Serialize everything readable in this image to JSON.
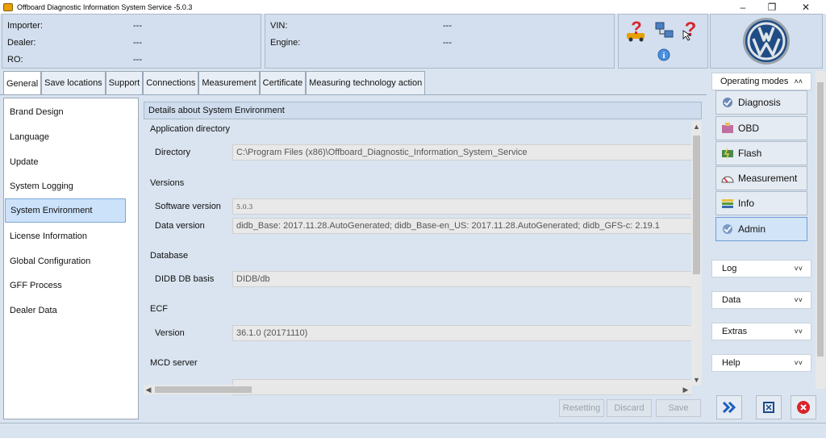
{
  "window": {
    "title": "Offboard Diagnostic Information System Service -5.0.3",
    "minimize_icon": "minimize-icon",
    "maximize_icon": "restore-icon",
    "close_icon": "close-icon"
  },
  "header": {
    "importer_label": "Importer:",
    "importer_value": "---",
    "dealer_label": "Dealer:",
    "dealer_value": "---",
    "ro_label": "RO:",
    "ro_value": "---",
    "vin_label": "VIN:",
    "vin_value": "---",
    "engine_label": "Engine:",
    "engine_value": "---"
  },
  "tabs": [
    {
      "label": "General"
    },
    {
      "label": "Save locations"
    },
    {
      "label": "Support"
    },
    {
      "label": "Connections"
    },
    {
      "label": "Measurement"
    },
    {
      "label": "Certificate"
    },
    {
      "label": "Measuring technology action"
    }
  ],
  "leftnav": [
    {
      "label": "Brand Design"
    },
    {
      "label": "Language"
    },
    {
      "label": "Update"
    },
    {
      "label": "System Logging"
    },
    {
      "label": "System Environment"
    },
    {
      "label": "License Information"
    },
    {
      "label": "Global Configuration"
    },
    {
      "label": "GFF Process"
    },
    {
      "label": "Dealer Data"
    }
  ],
  "content": {
    "header": "Details about System Environment",
    "sections": {
      "app_dir": "Application directory",
      "directory_label": "Directory",
      "directory_value": "C:\\Program Files (x86)\\Offboard_Diagnostic_Information_System_Service",
      "versions": "Versions",
      "software_label": "Software version",
      "software_value": "5.0.3",
      "data_label": "Data version",
      "data_value": "didb_Base: 2017.11.28.AutoGenerated; didb_Base-en_US: 2017.11.28.AutoGenerated; didb_GFS-c: 2.19.1",
      "database": "Database",
      "didb_label": "DIDB DB basis",
      "didb_value": "DIDB/db",
      "ecf": "ECF",
      "ecf_version_label": "Version",
      "ecf_version_value": "36.1.0 (20171110)",
      "mcd": "MCD server"
    },
    "buttons": {
      "resetting": "Resetting",
      "discard": "Discard",
      "save": "Save"
    }
  },
  "rightpanel": {
    "operating_modes": "Operating modes",
    "modes": [
      {
        "label": "Diagnosis"
      },
      {
        "label": "OBD"
      },
      {
        "label": "Flash"
      },
      {
        "label": "Measurement"
      },
      {
        "label": "Info"
      },
      {
        "label": "Admin"
      }
    ],
    "log": "Log",
    "data": "Data",
    "extras": "Extras",
    "help": "Help"
  },
  "colors": {
    "accent_red": "#d9232a",
    "selected_bg": "#cce2fb"
  }
}
